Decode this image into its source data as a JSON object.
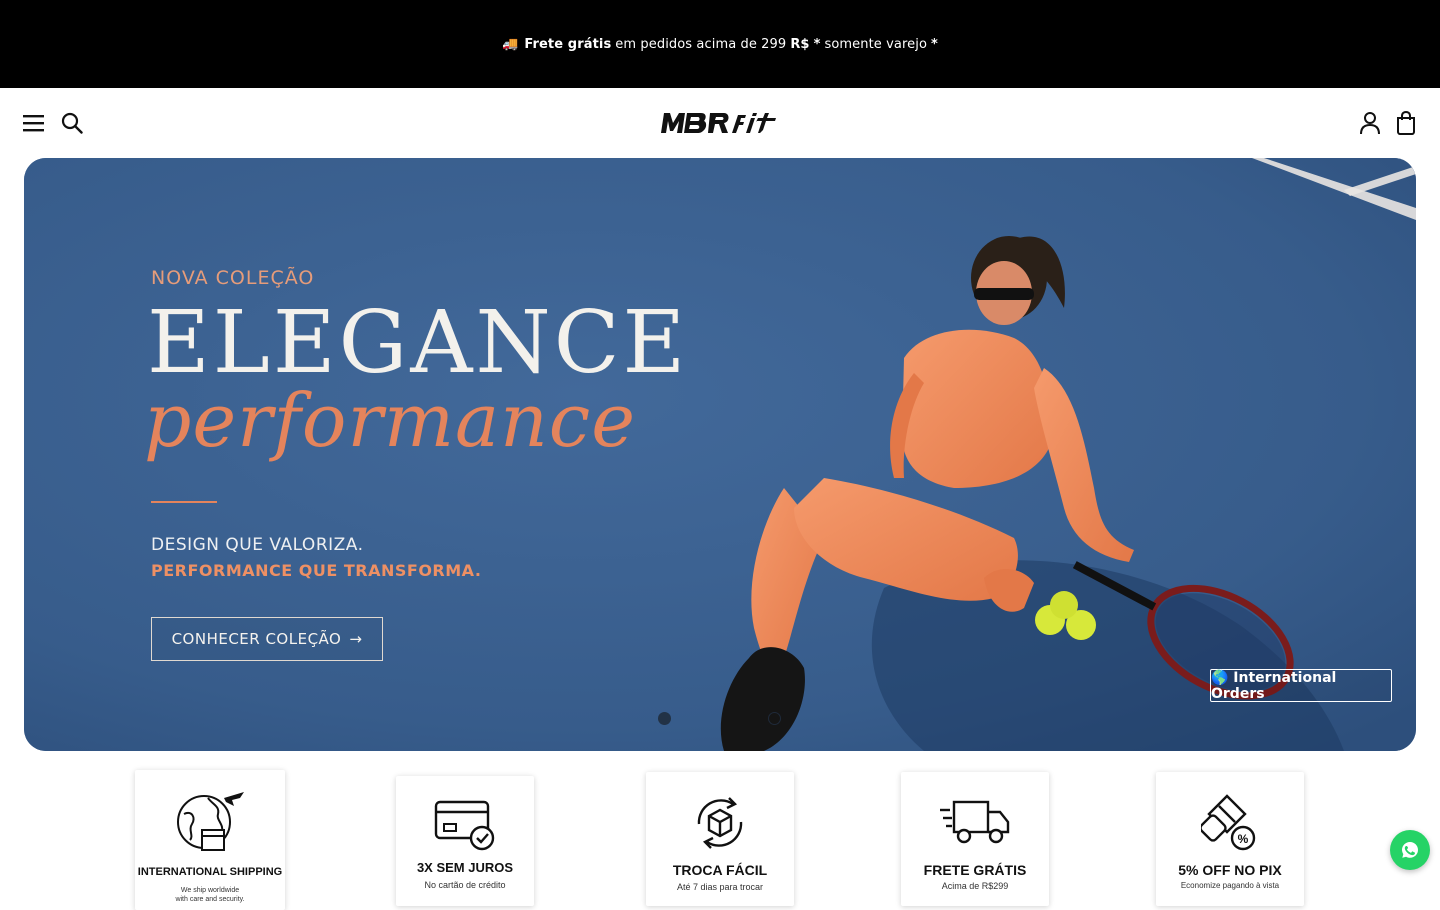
{
  "announcement": {
    "icon": "truck-icon",
    "bold": "Frete grátis",
    "text": "em pedidos acima de 299",
    "currency": "R$",
    "star1": "*",
    "retail": "somente varejo",
    "star2": "*"
  },
  "header": {
    "logo_text": "MBR fit",
    "menu_icon": "menu-icon",
    "search_icon": "search-icon",
    "account_icon": "account-icon",
    "cart_icon": "cart-icon"
  },
  "hero": {
    "eyebrow": "NOVA COLEÇÃO",
    "headline": "ELEGANCE",
    "headline_script": "performance",
    "subline1": "DESIGN QUE VALORIZA.",
    "subline2": "PERFORMANCE QUE TRANSFORMA.",
    "cta_label": "CONHECER COLEÇÃO",
    "cta_arrow": "→",
    "international_label": "🌎 International Orders",
    "slides_total": 2,
    "active_slide": 1,
    "colors": {
      "court": "#3a5f8f",
      "accent": "#e4845c",
      "outfit": "#f08a5d"
    }
  },
  "features": [
    {
      "title": "INTERNATIONAL SHIPPING",
      "sub": "We ship worldwide",
      "sub2": "with care and security.",
      "icon": "globe-plane-icon"
    },
    {
      "title": "3X SEM JUROS",
      "sub": "No cartão de crédito",
      "icon": "credit-card-icon"
    },
    {
      "title": "TROCA FÁCIL",
      "sub": "Até 7 dias para trocar",
      "icon": "box-exchange-icon"
    },
    {
      "title": "FRETE GRÁTIS",
      "sub": "Acima de R$299",
      "icon": "delivery-truck-icon"
    },
    {
      "title": "5% OFF NO PIX",
      "sub": "Economize pagando à vista",
      "icon": "pix-discount-icon"
    }
  ],
  "whatsapp": {
    "icon": "whatsapp-icon",
    "color": "#25d366"
  }
}
